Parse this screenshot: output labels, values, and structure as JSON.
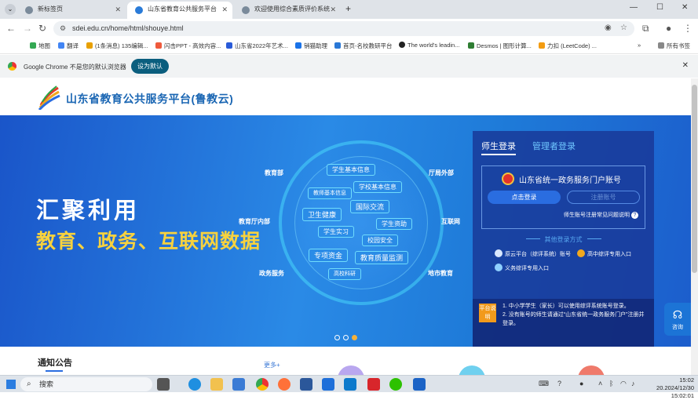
{
  "browser": {
    "tabs": [
      {
        "title": "新标签页",
        "active": false
      },
      {
        "title": "山东省教育公共服务平台",
        "active": true
      },
      {
        "title": "欢迎使用综合素质评价系统",
        "active": false
      }
    ],
    "new_tab_label": "+",
    "window_controls": {
      "minimize": "—",
      "maximize": "☐",
      "close": "✕"
    },
    "url": "sdei.edu.cn/home/html/shouye.html",
    "bookmarks": [
      {
        "label": "地图",
        "color": "#34a853"
      },
      {
        "label": "翻译",
        "color": "#4285f4"
      },
      {
        "label": "(1条消息) 135编辑...",
        "color": "#e8a000"
      },
      {
        "label": "闪击PPT - 高效内容...",
        "color": "#ef5a3c"
      },
      {
        "label": "山东省2022年艺术...",
        "color": "#2a5bd8"
      },
      {
        "label": "销猫助理",
        "color": "#1a73e8"
      },
      {
        "label": "首页-名校教研平台",
        "color": "#2a78d6"
      },
      {
        "label": "The world's leadin...",
        "color": "#222"
      },
      {
        "label": "Desmos | 图形计算...",
        "color": "#2e7d32"
      },
      {
        "label": "力扣 (LeetCode) ...",
        "color": "#f39c12"
      }
    ],
    "bookmarks_more": "»",
    "all_bookmarks": "所有书签",
    "infobar": {
      "message": "Google Chrome 不是您的默认浏览器",
      "button": "设为默认"
    }
  },
  "site": {
    "logo_text": "山东省教育公共服务平台(鲁教云)",
    "banner": {
      "slogan_line1": "汇聚利用",
      "slogan_line2": "教育、政务、互联网数据",
      "outer_labels": [
        "教育部",
        "厅局外部",
        "教育厅内部",
        "互联网",
        "政务服务",
        "地市教育"
      ],
      "chips": [
        "学生基本信息",
        "教师基本信息",
        "学校基本信息",
        "卫生健康",
        "国际交流",
        "学生实习",
        "学生资助",
        "校园安全",
        "专项资金",
        "教育质量监测",
        "高校科研"
      ]
    },
    "login": {
      "tab_active": "师生登录",
      "tab_inactive": "管理者登录",
      "portal_title": "山东省统一政务服务门户账号",
      "login_button": "点击登录",
      "register_button": "注册账号",
      "help_link": "师生账号注册常见问题说明",
      "help_icon": "?",
      "other_title": "其他登录方式",
      "options": [
        "原云平台（综评系统）账号",
        "高中综评专用入口",
        "义务综评专用入口"
      ],
      "notice_badge": "平台说明",
      "notice_lines": [
        "1. 中小学学生（家长）可以使用综评系统账号登录。",
        "2. 没有账号的师生请通过“山东省统一政务服务门户”注册并登录。"
      ]
    },
    "notice_section_title": "通知公告",
    "more_link": "更多+",
    "consult_label": "咨询"
  },
  "taskbar": {
    "search_label": "搜索",
    "time": "15:02",
    "date": "20.2024/12/30 15:02:01"
  },
  "colors": {
    "brand_blue": "#1a66b3",
    "banner_blue": "#1e7ad8",
    "slogan_yellow": "#f7d23e",
    "accent_orange": "#f29a1c"
  }
}
